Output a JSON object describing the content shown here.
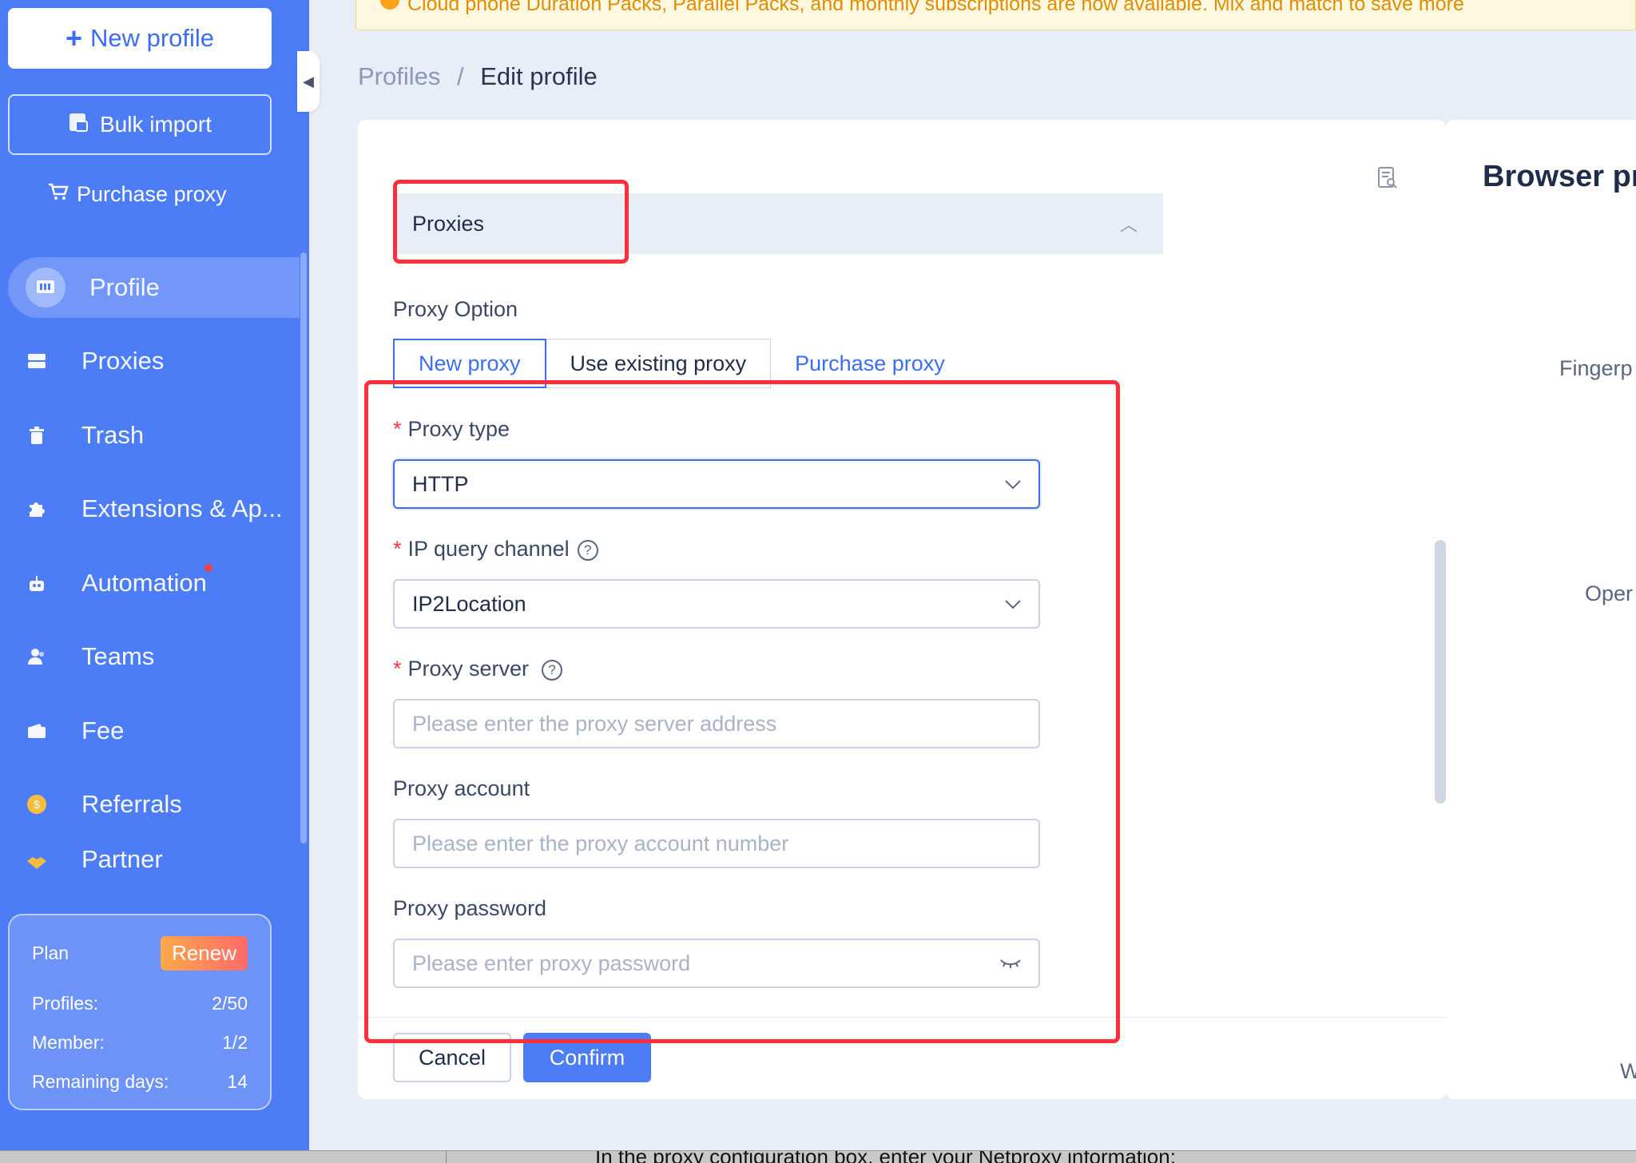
{
  "notice": {
    "text": "Cloud phone Duration Packs, Parallel Packs, and monthly subscriptions are now available. Mix and match to save more"
  },
  "sidebar": {
    "new_profile_label": "New profile",
    "bulk_import_label": "Bulk import",
    "purchase_proxy_label": "Purchase proxy",
    "items": [
      {
        "label": "Profile",
        "icon": "profile-icon"
      },
      {
        "label": "Proxies",
        "icon": "server-icon"
      },
      {
        "label": "Trash",
        "icon": "trash-icon"
      },
      {
        "label": "Extensions & Ap...",
        "icon": "puzzle-icon"
      },
      {
        "label": "Automation",
        "icon": "robot-icon"
      },
      {
        "label": "Teams",
        "icon": "users-icon"
      },
      {
        "label": "Fee",
        "icon": "wallet-icon"
      },
      {
        "label": "Referrals",
        "icon": "coin-icon"
      },
      {
        "label": "Partner",
        "icon": "handshake-icon"
      }
    ],
    "plan": {
      "title": "Plan",
      "renew_label": "Renew",
      "profiles_label": "Profiles:",
      "profiles_value": "2/50",
      "member_label": "Member:",
      "member_value": "1/2",
      "remaining_label": "Remaining days:",
      "remaining_value": "14"
    }
  },
  "breadcrumb": {
    "parent": "Profiles",
    "separator": "/",
    "current": "Edit profile"
  },
  "section": {
    "title": "Proxies"
  },
  "proxy_option": {
    "label": "Proxy Option",
    "tabs": [
      "New proxy",
      "Use existing proxy",
      "Purchase proxy"
    ]
  },
  "form": {
    "proxy_type": {
      "label": "Proxy type",
      "value": "HTTP"
    },
    "ip_query": {
      "label": "IP query channel",
      "value": "IP2Location"
    },
    "proxy_server": {
      "label": "Proxy server",
      "placeholder": "Please enter the proxy server address"
    },
    "proxy_account": {
      "label": "Proxy account",
      "placeholder": "Please enter the proxy account number"
    },
    "proxy_password": {
      "label": "Proxy password",
      "placeholder": "Please enter proxy password"
    }
  },
  "actions": {
    "cancel": "Cancel",
    "confirm": "Confirm"
  },
  "right_panel": {
    "title": "Browser pr",
    "labels": [
      "Fingerp",
      "Oper",
      "W"
    ]
  },
  "bottom_caption": "In the proxy configuration box, enter your Netproxy information:"
}
